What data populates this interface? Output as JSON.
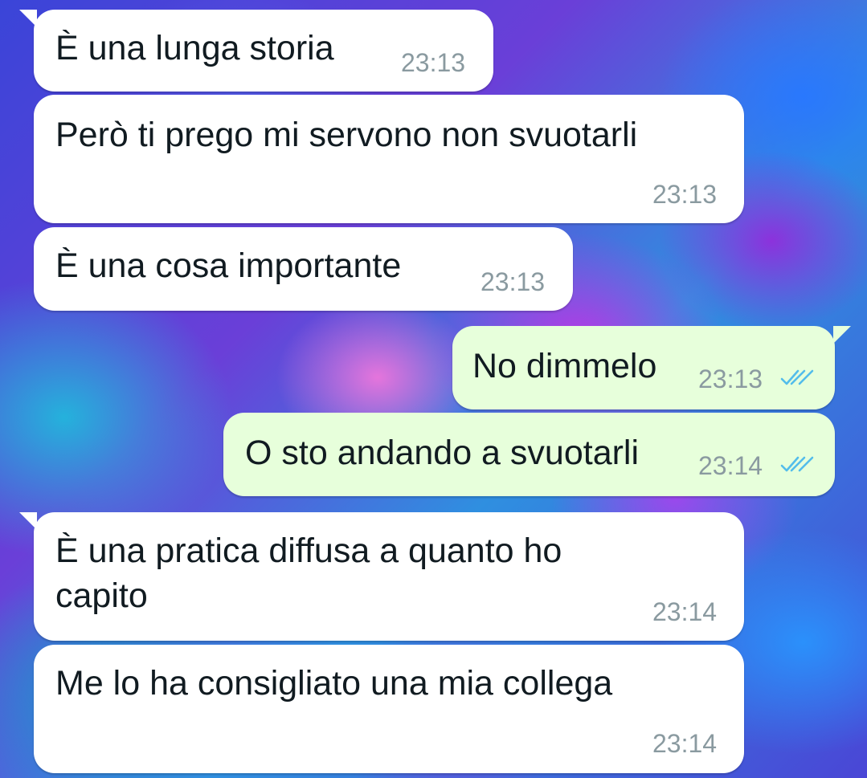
{
  "conversation": {
    "messages": [
      {
        "direction": "incoming",
        "text": "È una lunga storia",
        "time": "23:13"
      },
      {
        "direction": "incoming",
        "text": "Però ti prego mi servono non svuotarli",
        "time": "23:13"
      },
      {
        "direction": "incoming",
        "text": "È una cosa importante",
        "time": "23:13"
      },
      {
        "direction": "outgoing",
        "text": "No dimmelo",
        "time": "23:13",
        "status_icon": "double-check-read-icon"
      },
      {
        "direction": "outgoing",
        "text": "O sto andando a svuotarli",
        "time": "23:14",
        "status_icon": "double-check-read-icon"
      },
      {
        "direction": "incoming",
        "text": "È una pratica diffusa a quanto ho capito",
        "time": "23:14"
      },
      {
        "direction": "incoming",
        "text": "Me lo ha consigliato una mia collega",
        "time": "23:14"
      }
    ]
  },
  "colors": {
    "incoming_bubble": "#ffffff",
    "outgoing_bubble": "#e7ffdb",
    "text": "#111b21",
    "time": "#8a9aa0",
    "read_ticks": "#53bdeb"
  }
}
